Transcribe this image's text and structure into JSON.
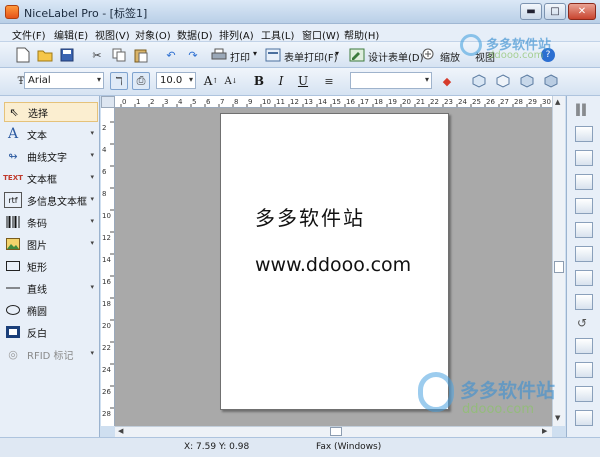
{
  "window": {
    "title": "NiceLabel Pro - [标签1]"
  },
  "window_controls": {
    "minimize": "▬",
    "maximize": "□",
    "close": "✕"
  },
  "menu": [
    "文件(F)",
    "编辑(E)",
    "视图(V)",
    "对象(O)",
    "数据(D)",
    "排列(A)",
    "工具(L)",
    "窗口(W)",
    "帮助(H)"
  ],
  "toolbar1": {
    "print_label": "打印",
    "form_print_label": "表单打印(F)",
    "design_form_label": "设计表单(D)",
    "zoom_in_label": "缩放",
    "view_label": "视图"
  },
  "toolbar2": {
    "font_name": "Arial",
    "font_size": "10.0",
    "bold": "B",
    "italic": "I",
    "underline": "U"
  },
  "toolbox": [
    {
      "label": "选择",
      "icon": "pointer-icon",
      "selected": true
    },
    {
      "label": "文本",
      "icon": "text-a-icon"
    },
    {
      "label": "曲线文字",
      "icon": "curve-text-icon"
    },
    {
      "label": "文本框",
      "icon": "text-box-icon"
    },
    {
      "label": "多信息文本框",
      "icon": "rich-text-icon"
    },
    {
      "label": "条码",
      "icon": "barcode-icon"
    },
    {
      "label": "图片",
      "icon": "picture-icon"
    },
    {
      "label": "矩形",
      "icon": "rectangle-icon"
    },
    {
      "label": "直线",
      "icon": "line-icon"
    },
    {
      "label": "椭圆",
      "icon": "ellipse-icon"
    },
    {
      "label": "反白",
      "icon": "inverse-icon"
    },
    {
      "label": "RFID 标记",
      "icon": "rfid-icon",
      "disabled": true
    }
  ],
  "ruler": {
    "h_labels": [
      "0",
      "1",
      "2",
      "3",
      "4",
      "5",
      "6",
      "7",
      "8",
      "9",
      "10",
      "11",
      "12",
      "13",
      "14",
      "15",
      "16",
      "17",
      "18",
      "19",
      "20",
      "21",
      "22",
      "23",
      "24",
      "25",
      "26",
      "27",
      "28",
      "29",
      "30"
    ],
    "v_labels": [
      "2",
      "4",
      "6",
      "8",
      "10",
      "12",
      "14",
      "16",
      "18",
      "20",
      "22",
      "24",
      "26",
      "28"
    ]
  },
  "label": {
    "line1": "多多软件站",
    "line2": "www.ddooo.com"
  },
  "status": {
    "coords": "X: 7.59 Y: 0.98",
    "printer": "Fax (Windows)"
  },
  "watermark": {
    "top_name": "多多软件站",
    "top_url": "ddooo.com",
    "bottom_name": "多多软件站",
    "bottom_url": "ddooo.com"
  }
}
